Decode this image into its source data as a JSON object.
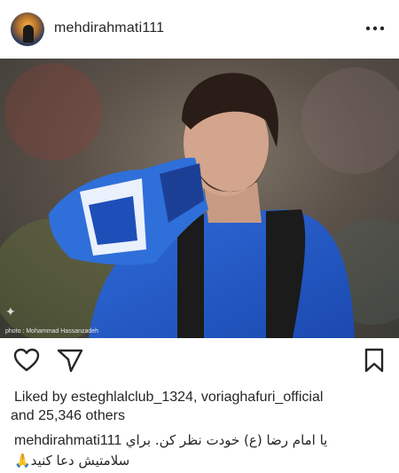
{
  "post": {
    "username": "mehdirahmati111",
    "more_icon": "ellipsis-icon",
    "photo_credit": "photo : Mohammad Hassanzadeh"
  },
  "actions": {
    "like_icon": "heart-icon",
    "share_icon": "paper-plane-icon",
    "save_icon": "bookmark-icon"
  },
  "likes": {
    "prefix": "Liked by ",
    "user1": "esteghlalclub_1324",
    "separator": ", ",
    "user2": "voriaghafuri_official",
    "and": " and ",
    "others": "25,346 others"
  },
  "caption": {
    "username": "mehdirahmati111",
    "line1": "یا امام رضا (ع) خودت نظر کن. براي",
    "line2": "سلامتیش دعا کنید🙏"
  }
}
